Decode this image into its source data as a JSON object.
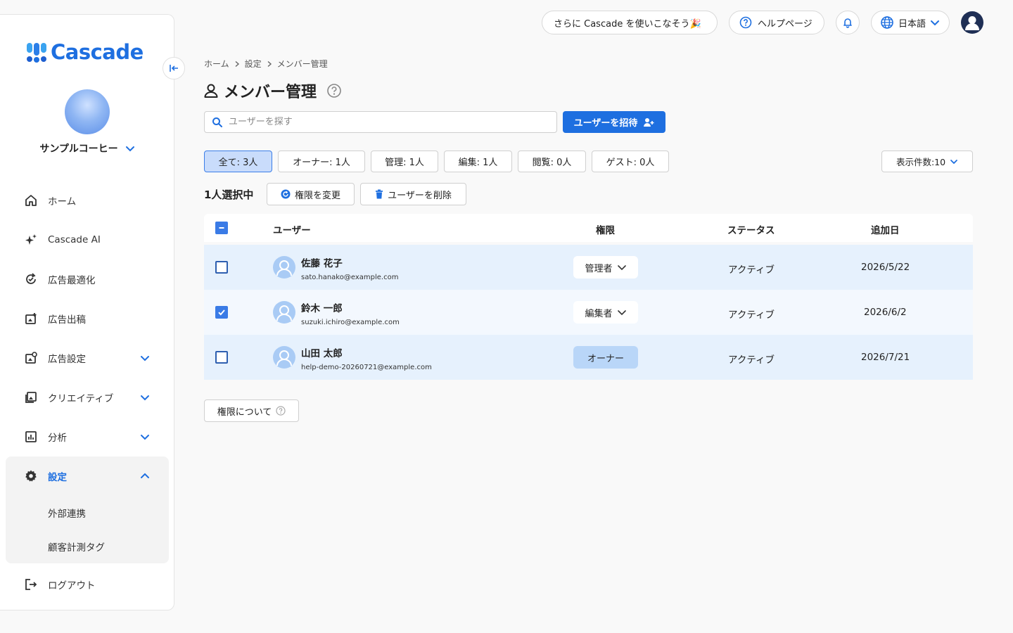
{
  "app": {
    "brand": "Cascade"
  },
  "sidebar": {
    "org_name": "サンプルコーヒー",
    "items": [
      {
        "label": "ホーム",
        "icon": "home-icon"
      },
      {
        "label": "Cascade AI",
        "icon": "sparkle-icon"
      },
      {
        "label": "広告最適化",
        "icon": "optimize-icon"
      },
      {
        "label": "広告出稿",
        "icon": "ad-post-icon"
      },
      {
        "label": "広告設定",
        "icon": "ad-settings-icon"
      },
      {
        "label": "クリエイティブ",
        "icon": "image-icon"
      },
      {
        "label": "分析",
        "icon": "chart-icon"
      },
      {
        "label": "設定",
        "icon": "gear-icon"
      }
    ],
    "settings_sub": [
      "外部連携",
      "顧客計測タグ"
    ],
    "logout": "ログアウト"
  },
  "header": {
    "promo": "さらに Cascade を使いこなそう🎉",
    "help": "ヘルプページ",
    "language": "日本語"
  },
  "breadcrumb": [
    "ホーム",
    "設定",
    "メンバー管理"
  ],
  "page_title": "メンバー管理",
  "search": {
    "placeholder": "ユーザーを探す"
  },
  "invite_label": "ユーザーを招待",
  "filters": [
    {
      "label": "全て: 3人"
    },
    {
      "label": "オーナー: 1人"
    },
    {
      "label": "管理: 1人"
    },
    {
      "label": "編集: 1人"
    },
    {
      "label": "閲覧: 0人"
    },
    {
      "label": "ゲスト: 0人"
    }
  ],
  "per_page": "表示件数:10",
  "selection": {
    "count": "1人選択中",
    "change_role": "権限を変更",
    "delete_user": "ユーザーを削除"
  },
  "table": {
    "headers": {
      "user": "ユーザー",
      "role": "権限",
      "status": "ステータス",
      "added": "追加日"
    },
    "rows": [
      {
        "name": "佐藤 花子",
        "email": "sato.hanako@example.com",
        "role": "管理者",
        "status": "アクティブ",
        "added": "2026/5/22",
        "checked": false
      },
      {
        "name": "鈴木 一郎",
        "email": "suzuki.ichiro@example.com",
        "role": "編集者",
        "status": "アクティブ",
        "added": "2026/6/2",
        "checked": true
      },
      {
        "name": "山田 太郎",
        "email": "help-demo-20260721@example.com",
        "role": "オーナー",
        "status": "アクティブ",
        "added": "2026/7/21",
        "checked": false
      }
    ]
  },
  "about_roles": "権限について",
  "colors": {
    "accent": "#1e6fe0",
    "row_highlight": "#e6f1fd",
    "filter_active": "#c9dcfb"
  }
}
